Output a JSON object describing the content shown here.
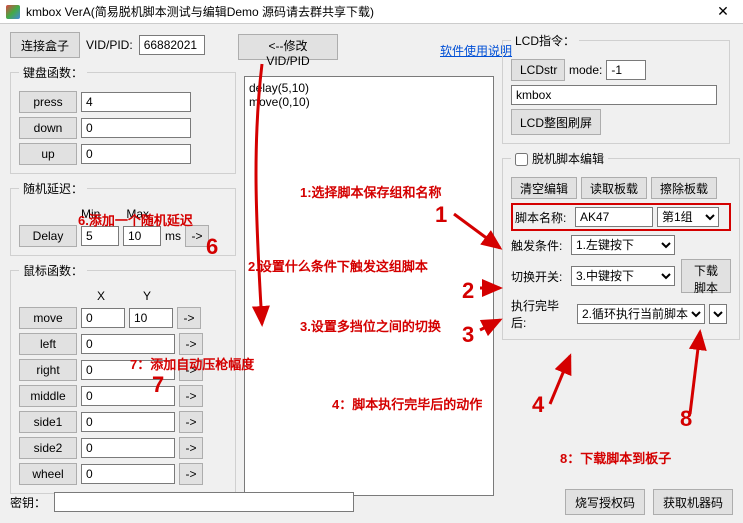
{
  "title": "kmbox VerA(简易脱机脚本测试与编辑Demo 源码请去群共享下载)",
  "top": {
    "connect": "连接盒子",
    "vidpid_lbl": "VID/PID:",
    "vidpid_val": "66882021",
    "modify": "<--修改VID/PID"
  },
  "link": "软件使用说明",
  "keyboard": {
    "legend": "键盘函数：",
    "press": "press",
    "press_v": "4",
    "down": "down",
    "down_v": "0",
    "up": "up",
    "up_v": "0"
  },
  "delay": {
    "legend": "随机延迟：",
    "btn": "Delay",
    "min_lbl": "Min",
    "min_v": "5",
    "max_lbl": "Max",
    "max_v": "10",
    "unit": "ms",
    "go": "->"
  },
  "mouse": {
    "legend": "鼠标函数：",
    "x_lbl": "X",
    "y_lbl": "Y",
    "move": "move",
    "move_x": "0",
    "move_y": "10",
    "left": "left",
    "left_v": "0",
    "right": "right",
    "right_v": "0",
    "middle": "middle",
    "middle_v": "0",
    "side1": "side1",
    "side1_v": "0",
    "side2": "side2",
    "side2_v": "0",
    "wheel": "wheel",
    "wheel_v": "0",
    "go": "->"
  },
  "script_text": "delay(5,10)\nmove(0,10)",
  "lcd": {
    "legend": "LCD指令：",
    "str_lbl": "LCDstr",
    "mode_lbl": "mode:",
    "mode_v": "-1",
    "txt": "kmbox",
    "refresh": "LCD整图刷屏"
  },
  "offline_ck": "脱机脚本编辑",
  "act": {
    "clear": "清空编辑",
    "read": "读取板载",
    "erase": "擦除板载",
    "name_lbl": "脚本名称:",
    "name_v": "AK47",
    "group": "第1组",
    "trig_lbl": "触发条件:",
    "trig_v": "1.左键按下",
    "sw_lbl": "切换开关:",
    "sw_v": "3.中键按下",
    "done_lbl": "执行完毕后:",
    "done_v": "2.循环执行当前脚本",
    "download": "下载脚本"
  },
  "bottom": {
    "key_lbl": "密钥：",
    "key_v": "",
    "burn": "烧写授权码",
    "getid": "获取机器码"
  },
  "ann": {
    "a1": "1:选择脚本保存组和名称",
    "a2": "2.设置什么条件下触发这组脚本",
    "a3": "3.设置多挡位之间的切换",
    "a4": "4：脚本执行完毕后的动作",
    "a6": "6.添加一个随机延迟",
    "a7": "7：添加自动压枪幅度",
    "a8": "8：下载脚本到板子",
    "n1": "1",
    "n2": "2",
    "n3": "3",
    "n4": "4",
    "n6": "6",
    "n7": "7",
    "n8": "8"
  }
}
